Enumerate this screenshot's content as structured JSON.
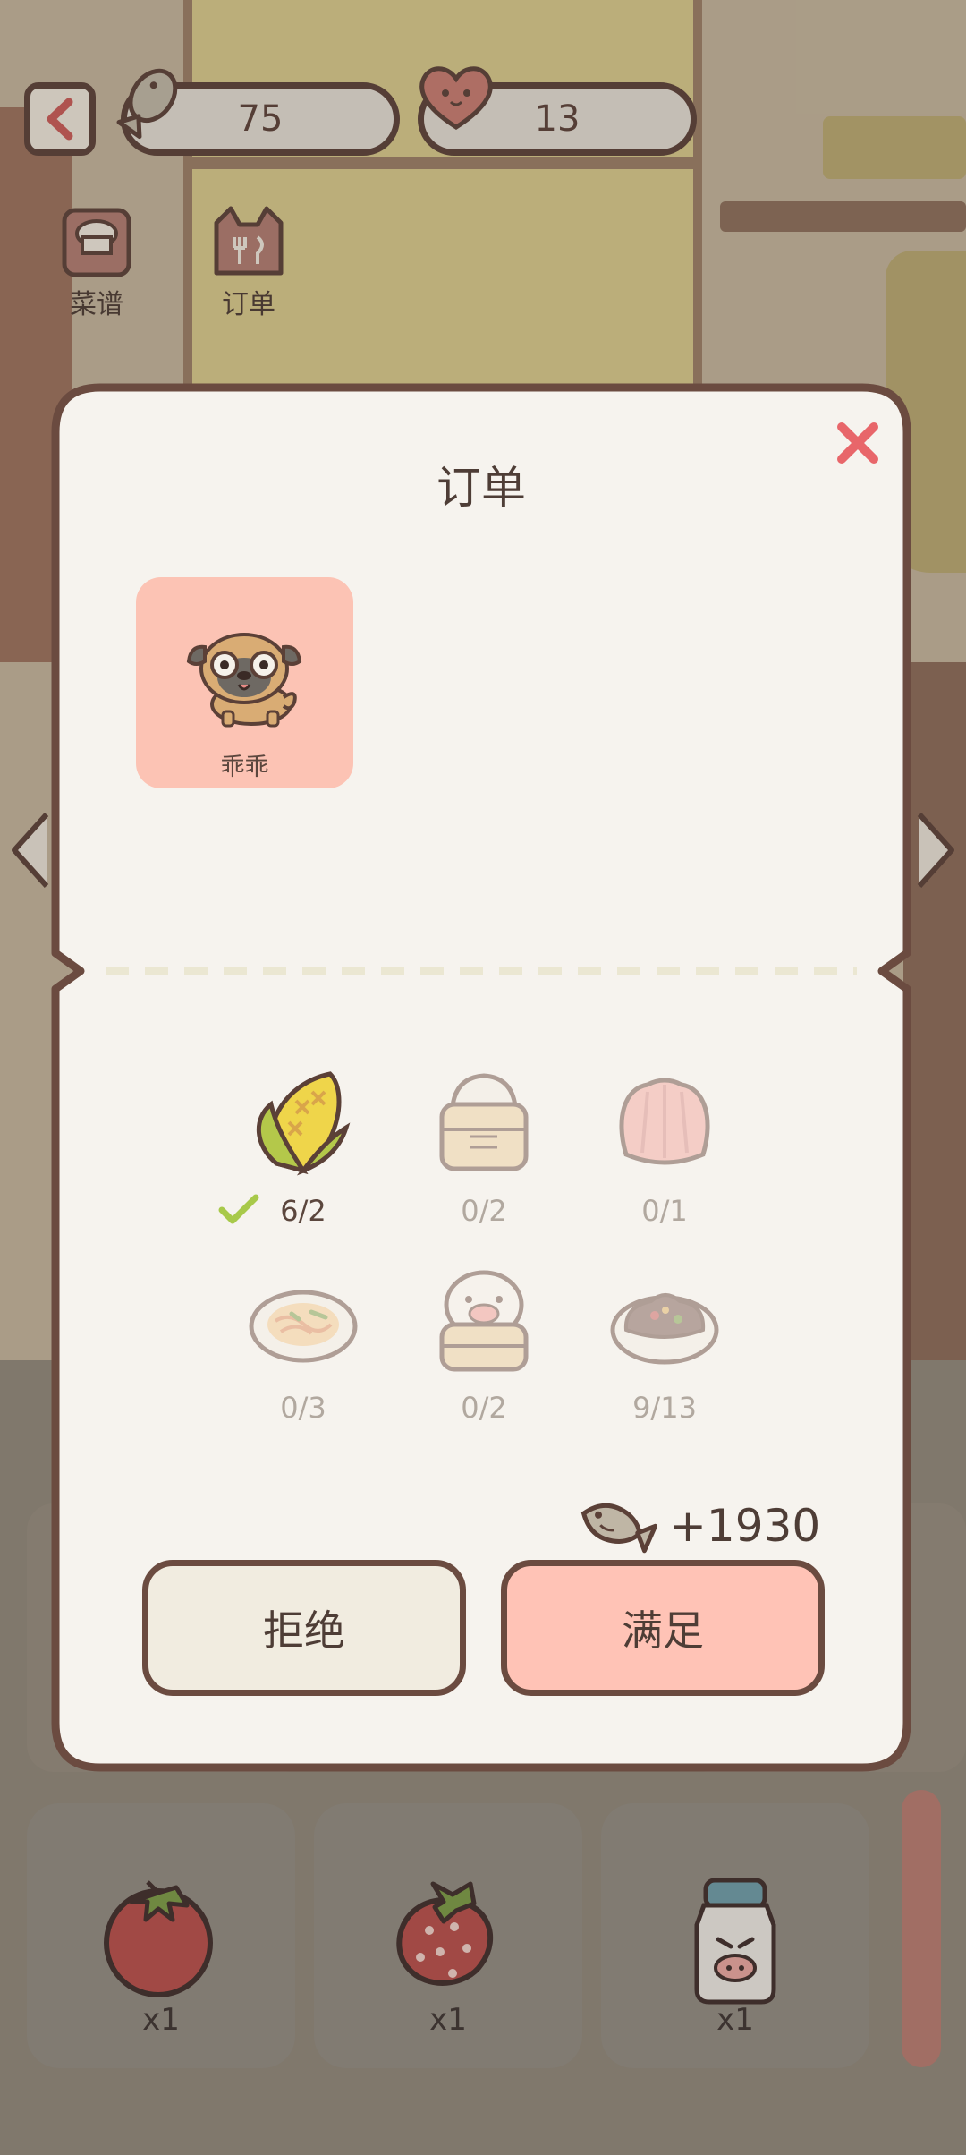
{
  "hud": {
    "fish_count": "75",
    "heart_count": "13",
    "tabs": [
      {
        "label": "菜谱",
        "icon": "recipe-book-icon"
      },
      {
        "label": "订单",
        "icon": "cat-order-icon"
      }
    ]
  },
  "modal": {
    "title": "订单",
    "customer": {
      "name": "乖乖",
      "icon": "pug-dog-icon"
    },
    "dishes": [
      {
        "icon": "corn-icon",
        "progress": "6/2",
        "completed": true
      },
      {
        "icon": "steamed-bun-basket-icon",
        "progress": "0/2",
        "completed": false
      },
      {
        "icon": "pink-jelly-icon",
        "progress": "0/1",
        "completed": false
      },
      {
        "icon": "noodle-plate-icon",
        "progress": "0/3",
        "completed": false
      },
      {
        "icon": "piggy-bun-basket-icon",
        "progress": "0/2",
        "completed": false
      },
      {
        "icon": "stew-plate-icon",
        "progress": "9/13",
        "completed": false
      }
    ],
    "reward": {
      "icon": "fish-icon",
      "text": "+1930"
    },
    "reject_label": "拒绝",
    "accept_label": "满足"
  },
  "inventory": [
    {
      "icon": "tomato-icon",
      "qty": "x1"
    },
    {
      "icon": "strawberry-icon",
      "qty": "x1"
    },
    {
      "icon": "milk-jar-icon",
      "qty": "x1"
    }
  ],
  "colors": {
    "outline": "#5b4037",
    "modal_bg": "#f6f3ee",
    "card_pink": "#fcc3b4",
    "accept_pink": "#ffc3b6",
    "reject_cream": "#f1ece0",
    "close_red": "#e8666a",
    "check_green": "#a8c94a"
  }
}
